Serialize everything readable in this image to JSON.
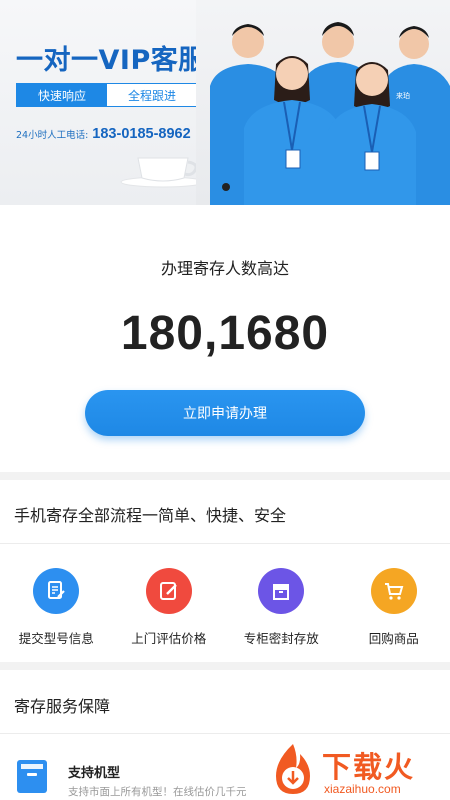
{
  "banner": {
    "title": "一对一VIP客服",
    "tabs": [
      {
        "label": "快速响应",
        "active": true
      },
      {
        "label": "全程跟进",
        "active": false
      }
    ],
    "hotline_label": "24小时人工电话:",
    "hotline_number": "183-0185-8962",
    "badge_text": "来珀"
  },
  "stats": {
    "label": "办理寄存人数高达",
    "number": "180,1680"
  },
  "cta": {
    "label": "立即申请办理"
  },
  "process": {
    "title": "手机寄存全部流程一简单、快捷、安全",
    "steps": [
      {
        "label": "提交型号信息",
        "icon": "document-edit-icon",
        "color": "#2d8ff0"
      },
      {
        "label": "上门评估价格",
        "icon": "edit-pen-icon",
        "color": "#f04a3e"
      },
      {
        "label": "专柜密封存放",
        "icon": "archive-box-icon",
        "color": "#6c55e6"
      },
      {
        "label": "回购商品",
        "icon": "shopping-cart-icon",
        "color": "#f5a623"
      }
    ]
  },
  "guarantee": {
    "title": "寄存服务保障",
    "items": [
      {
        "title": "支持机型",
        "desc": "支持市面上所有机型！在线估价几千元",
        "icon": "phone-box-icon"
      }
    ]
  },
  "watermark": {
    "name": "下载火",
    "site": "xiazaihuo.com"
  },
  "colors": {
    "primary": "#1e88e5",
    "title_blue": "#1565c0",
    "watermark": "#f15a22"
  }
}
